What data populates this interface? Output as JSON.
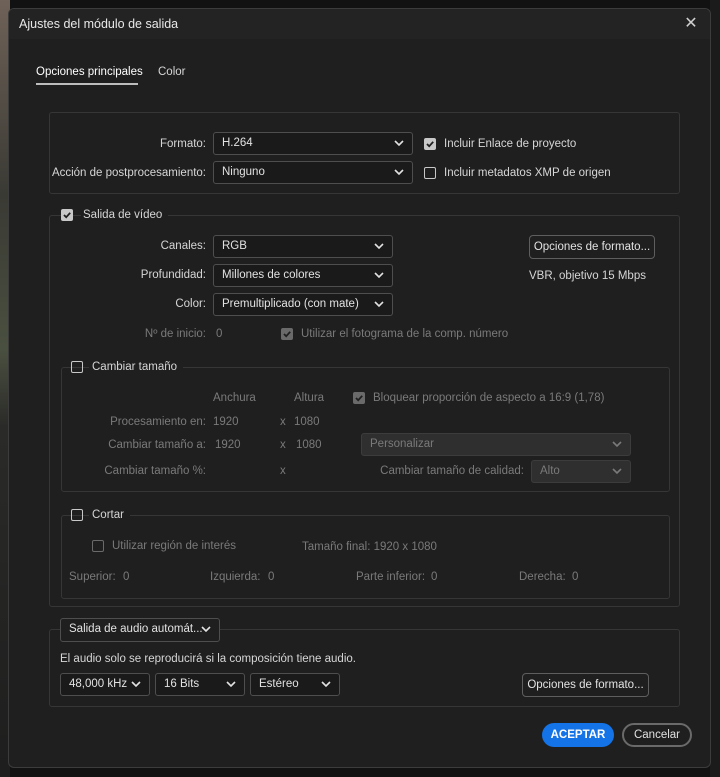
{
  "window": {
    "title": "Ajustes del módulo de salida"
  },
  "tabs": [
    {
      "label": "Opciones principales",
      "active": true
    },
    {
      "label": "Color",
      "active": false
    }
  ],
  "main": {
    "format_label": "Formato:",
    "format_value": "H.264",
    "postprocess_label": "Acción de postprocesamiento:",
    "postprocess_value": "Ninguno",
    "include_project_link": {
      "label": "Incluir Enlace de proyecto",
      "checked": true
    },
    "include_xmp": {
      "label": "Incluir metadatos XMP de origen",
      "checked": false
    }
  },
  "video": {
    "section_label": "Salida de vídeo",
    "checked": true,
    "channels_label": "Canales:",
    "channels_value": "RGB",
    "depth_label": "Profundidad:",
    "depth_value": "Millones de colores",
    "color_label": "Color:",
    "color_value": "Premultiplicado (con mate)",
    "start_label": "Nº de inicio:",
    "start_value": "0",
    "use_comp_frame": {
      "label": "Utilizar el fotograma de la comp. número",
      "checked": true
    },
    "format_options_button": "Opciones de formato...",
    "format_summary": "VBR, objetivo 15 Mbps"
  },
  "resize": {
    "section_label": "Cambiar tamaño",
    "checked": false,
    "width_header": "Anchura",
    "height_header": "Altura",
    "lock_aspect": {
      "label": "Bloquear proporción de aspecto a 16:9 (1,78)",
      "checked": true
    },
    "rendering_label": "Procesamiento en:",
    "rendering_w": "1920",
    "rendering_h": "1080",
    "resize_to_label": "Cambiar tamaño a:",
    "resize_to_w": "1920",
    "resize_to_h": "1080",
    "times": "x",
    "preset_value": "Personalizar",
    "percent_label": "Cambiar tamaño %:",
    "quality_label": "Cambiar tamaño de calidad:",
    "quality_value": "Alto"
  },
  "crop": {
    "section_label": "Cortar",
    "checked": false,
    "roi": {
      "label": "Utilizar región de interés",
      "checked": false
    },
    "final_size": "Tamaño final: 1920 x 1080",
    "top_label": "Superior:",
    "top_value": "0",
    "left_label": "Izquierda:",
    "left_value": "0",
    "bottom_label": "Parte inferior:",
    "bottom_value": "0",
    "right_label": "Derecha:",
    "right_value": "0"
  },
  "audio": {
    "output_value": "Salida de audio automát...",
    "note": "El audio solo se reproducirá si la composición tiene audio.",
    "rate_value": "48,000 kHz",
    "bits_value": "16 Bits",
    "channels_value": "Estéreo",
    "format_options_button": "Opciones de formato..."
  },
  "footer": {
    "ok_label": "ACEPTAR",
    "cancel_label": "Cancelar"
  },
  "colors": {
    "accent": "#1473e6",
    "background": "#1f1f1f",
    "border": "#363636"
  }
}
